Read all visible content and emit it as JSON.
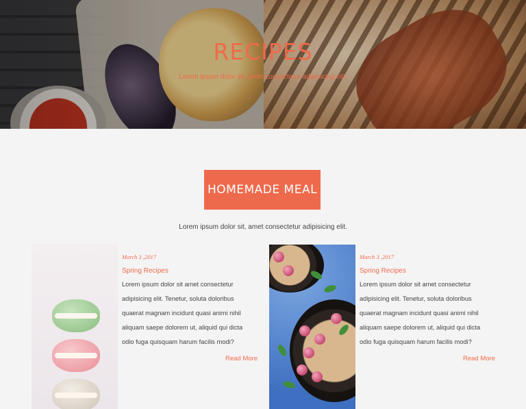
{
  "hero": {
    "title": "RECIPES",
    "subtitle": "Lorem ipsum dolor sit, amet consectetur adipisicing elit."
  },
  "section": {
    "badge": "HOMEMADE MEAL",
    "intro": "Lorem ipsum dolor sit, amet consectetur adipisicing elit."
  },
  "posts": [
    {
      "date": "March 3 ,2017",
      "category": "Spring Recipes",
      "excerpt": "Lorem ipsum dolor sit amet consectetur adipisicing elit. Tenetur, soluta doloribus quaerat magnam incidunt quasi animi nihil aliquam saepe dolorem ut, aliquid qui dicta odio fuga quisquam harum facilis modi?",
      "read_more": "Read More",
      "image": "macaron-stack-photo"
    },
    {
      "date": "March 3 ,2017",
      "category": "Spring Recipes",
      "excerpt": "Lorem ipsum dolor sit amet consectetur adipisicing elit. Tenetur, soluta doloribus quaerat magnam incidunt quasi animi nihil aliquam saepe dolorem ut, aliquid qui dicta odio fuga quisquam harum facilis modi?",
      "read_more": "Read More",
      "image": "berry-skillet-photo"
    }
  ],
  "colors": {
    "accent": "#ee6a4c",
    "background": "#f5f4f4",
    "text": "#444444"
  }
}
